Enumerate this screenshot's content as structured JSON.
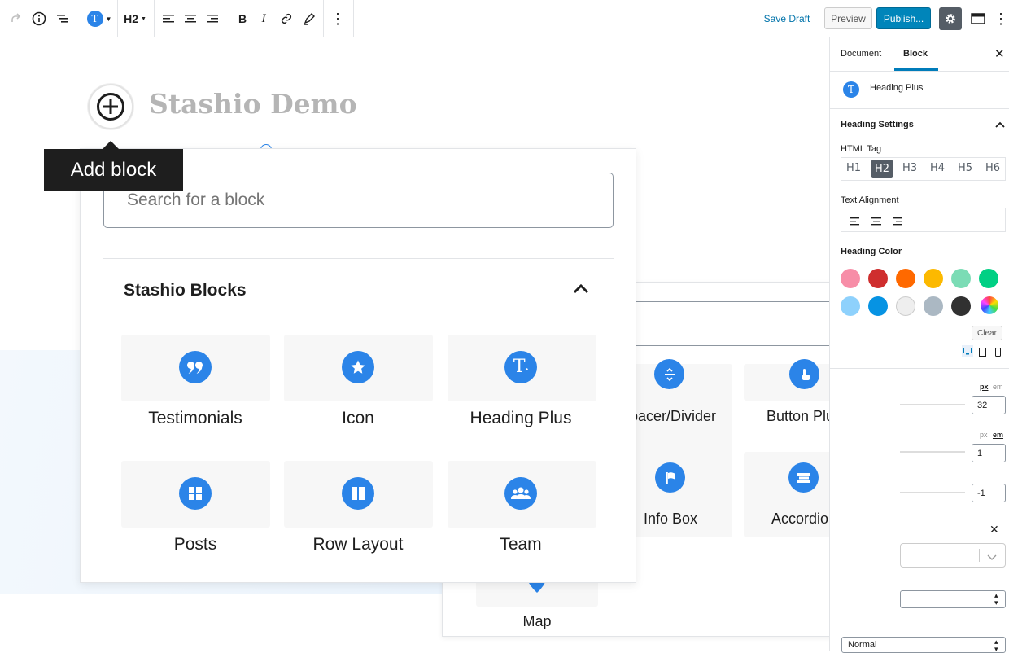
{
  "toolbar": {
    "save_draft": "Save Draft",
    "preview": "Preview",
    "publish": "Publish...",
    "heading_level": "H2"
  },
  "editor": {
    "title": "Stashio Demo"
  },
  "tooltip": {
    "add_block": "Add block"
  },
  "inserter": {
    "search_placeholder": "Search for a block",
    "category": "Stashio Blocks",
    "blocks": [
      {
        "label": "Testimonials",
        "icon": "quote-icon"
      },
      {
        "label": "Icon",
        "icon": "star-icon"
      },
      {
        "label": "Heading Plus",
        "icon": "heading-icon"
      },
      {
        "label": "Posts",
        "icon": "grid-icon"
      },
      {
        "label": "Row Layout",
        "icon": "columns-icon"
      },
      {
        "label": "Team",
        "icon": "team-icon"
      }
    ]
  },
  "inserter_back": {
    "blocks": [
      {
        "label": "pacer/Divider",
        "icon": "divider-icon"
      },
      {
        "label": "Button Plus",
        "icon": "pointer-icon"
      },
      {
        "label": "Info Box",
        "icon": "flag-icon"
      },
      {
        "label": "Accordion",
        "icon": "accordion-icon"
      },
      {
        "label": "Map",
        "icon": "map-pin-icon"
      }
    ]
  },
  "sidebar": {
    "tab_document": "Document",
    "tab_block": "Block",
    "block_name": "Heading Plus",
    "panel_title": "Heading Settings",
    "html_tag_label": "HTML Tag",
    "tags": [
      "H1",
      "H2",
      "H3",
      "H4",
      "H5",
      "H6"
    ],
    "text_alignment_label": "Text Alignment",
    "heading_color_label": "Heading Color",
    "clear": "Clear",
    "unit_px": "px",
    "unit_em": "em",
    "font_size_value": "32",
    "line_height_value": "1",
    "letter_spacing_value": "-1",
    "font_weight_value": "Normal",
    "colors": [
      "#f78da7",
      "#cf2e2e",
      "#ff6900",
      "#fcb900",
      "#7bdcb5",
      "#00d084",
      "#8ed1fc",
      "#0693e3",
      "#eeeeee",
      "#abb8c3",
      "#313131"
    ]
  }
}
